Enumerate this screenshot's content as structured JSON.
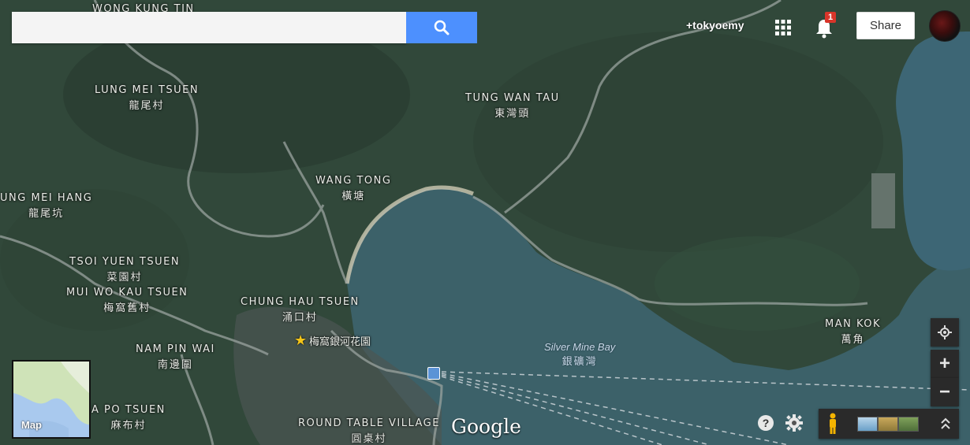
{
  "search": {
    "placeholder": "",
    "value": ""
  },
  "header": {
    "user_link": "+tokyoemy",
    "notifications_count": "1",
    "share_label": "Share"
  },
  "places": [
    {
      "name": "WONG KUNG TIN",
      "zh": ""
    },
    {
      "name": "LUNG MEI TSUEN",
      "zh": "龍尾村"
    },
    {
      "name": "TUNG WAN TAU",
      "zh": "東灣頭"
    },
    {
      "name": "WANG TONG",
      "zh": "橫塘"
    },
    {
      "name": "UNG MEI HANG",
      "zh": "龍尾坑"
    },
    {
      "name": "TSOI YUEN TSUEN",
      "zh": "菜園村"
    },
    {
      "name": "MUI WO KAU TSUEN",
      "zh": "梅窩舊村"
    },
    {
      "name": "CHUNG HAU TSUEN",
      "zh": "涌口村"
    },
    {
      "name": "NAM PIN WAI",
      "zh": "南邊圍"
    },
    {
      "name": "A PO TSUEN",
      "zh": "麻布村"
    },
    {
      "name": "ROUND TABLE VILLAGE",
      "zh": "圓桌村"
    },
    {
      "name": "MAN KOK",
      "zh": "萬角"
    }
  ],
  "poi": {
    "label": "梅窩銀河花園",
    "icon": "star-icon"
  },
  "water": {
    "name": "Silver Mine Bay",
    "zh": "銀礦灣"
  },
  "minimap": {
    "label": "Map"
  },
  "branding": {
    "logo": "Google"
  },
  "icons": {
    "search": "search-icon",
    "apps": "apps-grid-icon",
    "notifications": "bell-icon",
    "locate": "my-location-icon",
    "zoom_in": "+",
    "zoom_out": "−",
    "help": "help-icon",
    "settings": "gear-icon",
    "pegman": "pegman-icon",
    "expand": "chevron-up-double-icon"
  },
  "colors": {
    "search_button": "#4d90fe",
    "notification_badge": "#d9352a",
    "water": "#3c6169"
  }
}
